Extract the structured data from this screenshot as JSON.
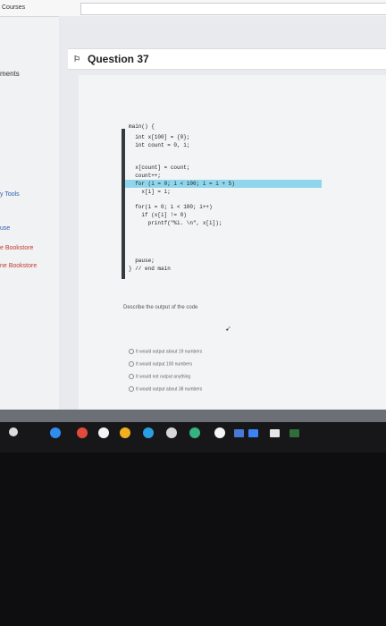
{
  "browser": {
    "tab_label": "Courses"
  },
  "sidebar": {
    "items": [
      "ments",
      "y Tools",
      "use",
      "e Bookstore",
      "ne Bookstore"
    ]
  },
  "question": {
    "title": "Question 37",
    "flag_icon": "flag-icon"
  },
  "code": {
    "lines": [
      "main() {",
      "  int x[100] = {0};",
      "  int count = 0, i;",
      "",
      "  x[count] = count;",
      "  count++;",
      "  for (i = 0; i < 100; i = i + 5)",
      "    x[i] = i;",
      "",
      "  for(i = 0; i < 100; i++)",
      "    if (x[i] != 0)",
      "      printf(\"%i. \\n\", x[i]);",
      "",
      "  pause;",
      "} // end main"
    ]
  },
  "prompt": {
    "text": "Describe the output of the code"
  },
  "options": [
    "It would output about 19 numbers",
    "It would output 100 numbers",
    "It would not output anything",
    "It would output about 38 numbers"
  ],
  "colors": {
    "highlight": "#8fd6ec",
    "code_bar": "#333a40"
  }
}
